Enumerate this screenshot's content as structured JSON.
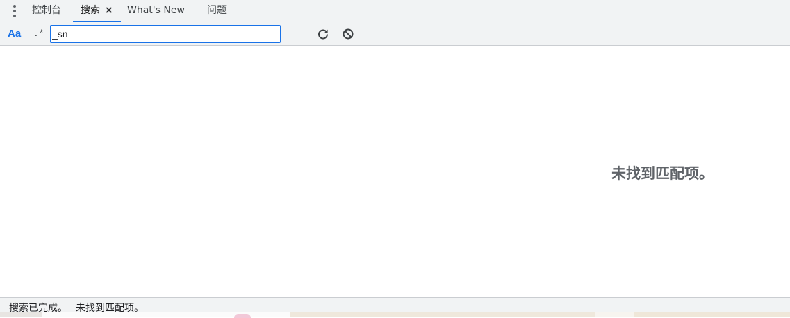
{
  "tabs": [
    {
      "label": "控制台"
    },
    {
      "label": "搜索",
      "close": "×"
    },
    {
      "label": "What's New"
    },
    {
      "label": "问题"
    }
  ],
  "toolbar": {
    "match_case_label": "Aa",
    "regex_label": ".*",
    "search_value": "_sn",
    "refresh_icon": "refresh-icon",
    "clear_icon": "clear-icon"
  },
  "main": {
    "empty_message": "未找到匹配项。"
  },
  "status": {
    "search_done": "搜索已完成。",
    "no_match": "未找到匹配项。"
  },
  "colors": {
    "accent": "#1a73e8",
    "toolbar_bg": "#f1f3f4",
    "border": "#cacdd1",
    "muted_text": "#5f6368"
  }
}
